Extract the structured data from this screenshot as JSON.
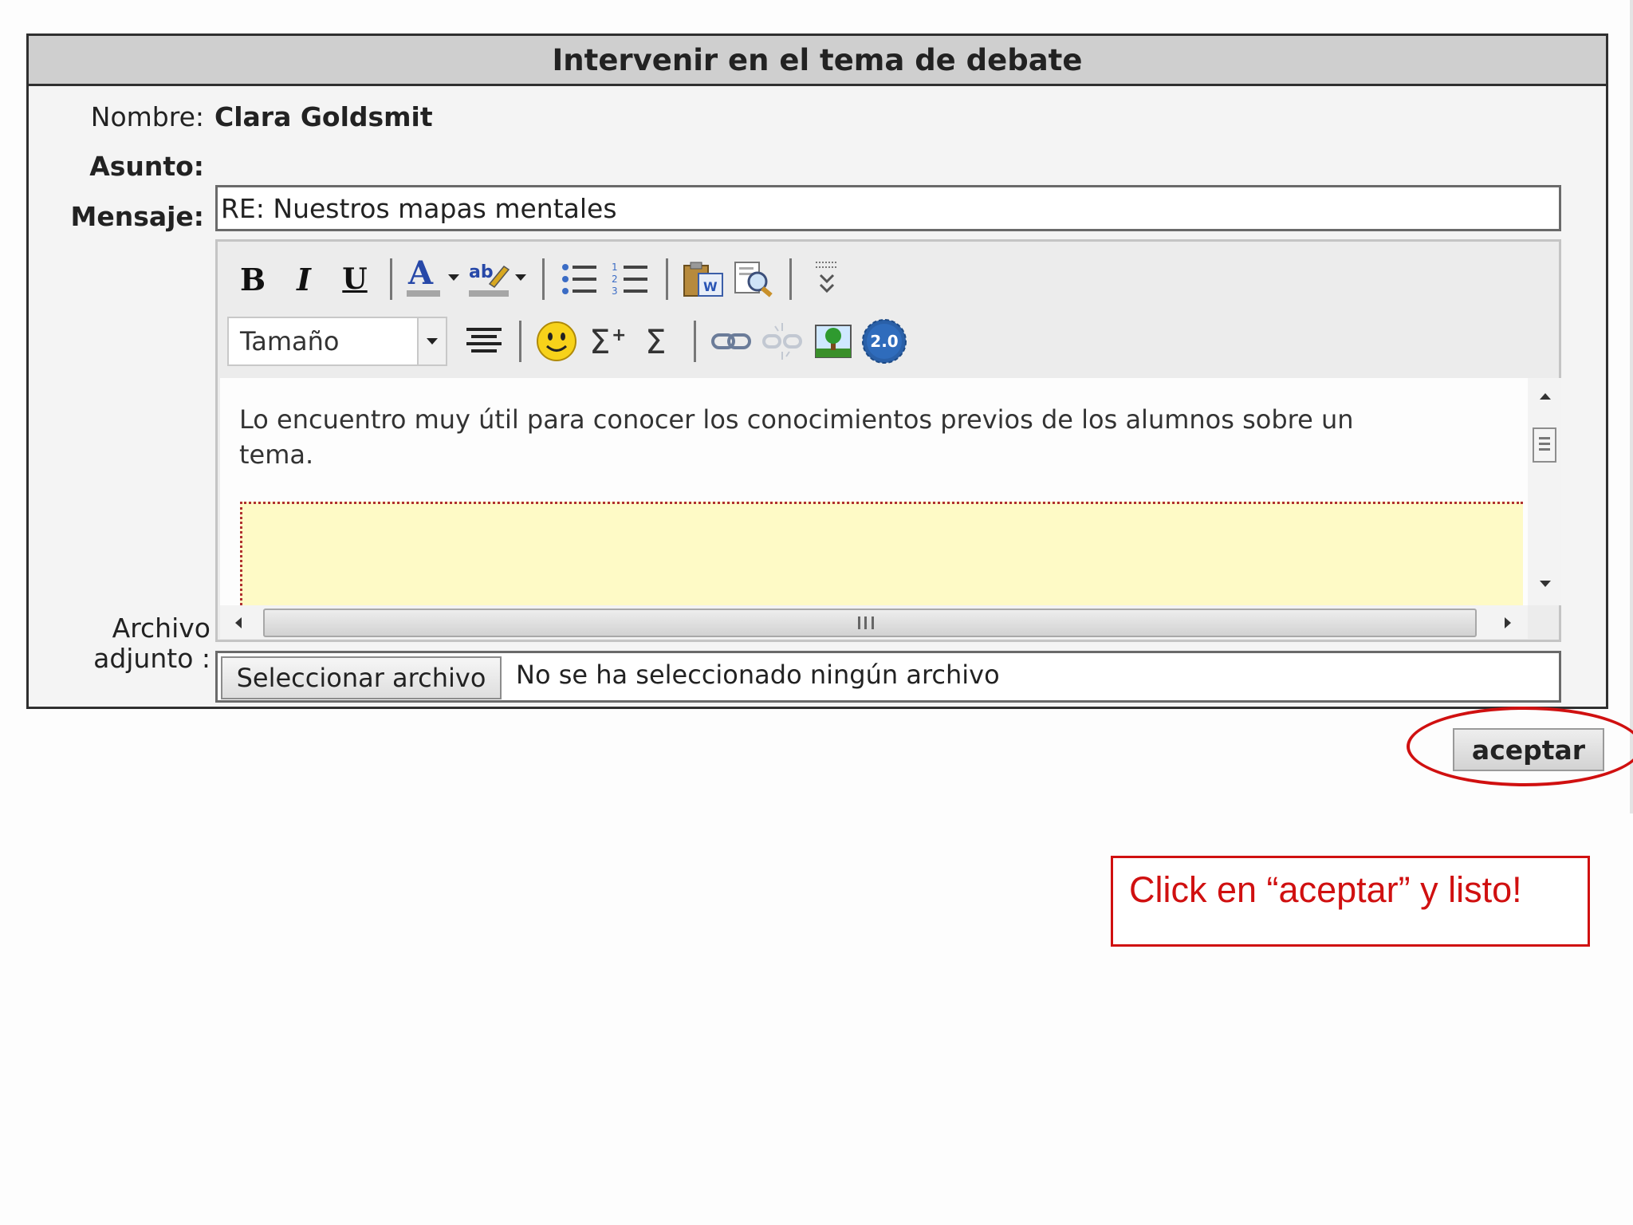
{
  "panel": {
    "title": "Intervenir en el tema de debate"
  },
  "form": {
    "nombre_label": "Nombre:",
    "nombre_value": "Clara Goldsmit",
    "asunto_label": "Asunto:",
    "asunto_value": "RE: Nuestros mapas mentales",
    "mensaje_label": "Mensaje:",
    "archivo_label_line1": "Archivo",
    "archivo_label_line2": "adjunto :"
  },
  "editor": {
    "size_select": "Tamaño",
    "content_text": "Lo encuentro muy útil para conocer los conocimientos previos de los alumnos sobre un tema.",
    "badge_text": "2.0",
    "toolbar_icons": [
      "bold-icon",
      "italic-icon",
      "underline-icon",
      "font-color-icon",
      "highlight-color-icon",
      "bullet-list-icon",
      "numbered-list-icon",
      "paste-word-icon",
      "find-icon",
      "more-tools-icon",
      "align-center-icon",
      "smiley-icon",
      "sum-plus-icon",
      "sum-icon",
      "link-icon",
      "unlink-icon",
      "insert-image-icon",
      "web20-icon"
    ],
    "colors": {
      "text_color_bar": "#a6a6a6",
      "highlight_bar": "#a6a6a6",
      "editable_bg": "#fefac6",
      "dotted_border": "#b03030"
    }
  },
  "attachment": {
    "button_label": "Seleccionar archivo",
    "status": "No se ha seleccionado ningún archivo"
  },
  "actions": {
    "accept_label": "aceptar"
  },
  "annotation": {
    "text": "Click en “aceptar” y listo!",
    "color": "#d01010"
  }
}
